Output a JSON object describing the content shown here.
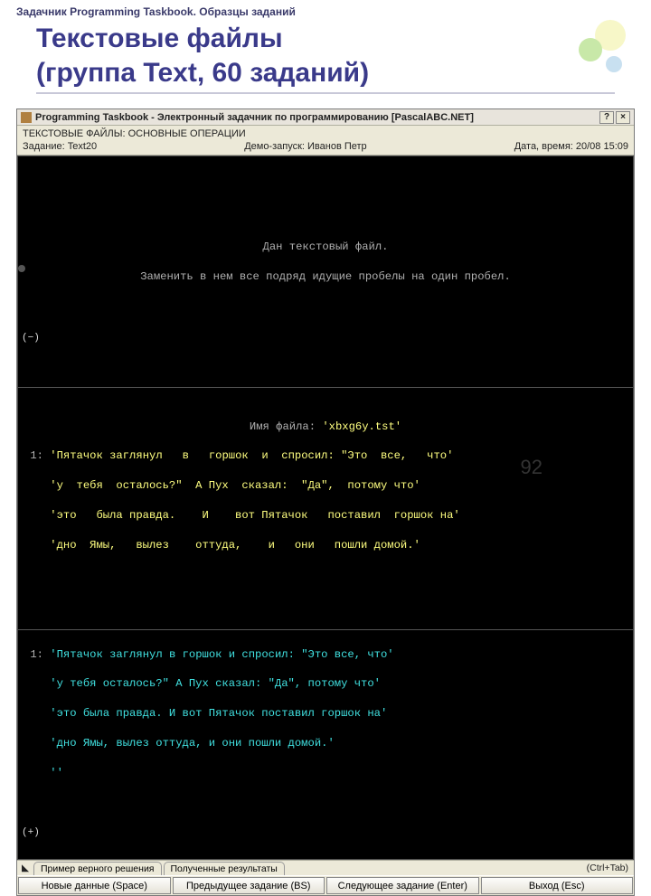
{
  "breadcrumb": "Задачник Programming Taskbook. Образцы заданий",
  "page_title_line1": "Текстовые файлы",
  "page_title_line2": "(группа Text, 60 заданий)",
  "window": {
    "title": "Programming Taskbook - Электронный задачник по программированию [PascalABC.NET]",
    "help_label": "?",
    "close_label": "×",
    "info": {
      "category": "ТЕКСТОВЫЕ ФАЙЛЫ: ОСНОВНЫЕ ОПЕРАЦИИ",
      "task_label": "Задание: Text20",
      "demo_label": "Демо-запуск: Иванов Петр",
      "datetime_label": "Дата, время: 20/08 15:09"
    }
  },
  "terminal": {
    "problem_line1": "Дан текстовый файл.",
    "problem_line2": "Заменить в нем все подряд идущие пробелы на один пробел.",
    "minus_mark": "(−)",
    "plus_mark": "(+)",
    "filename_prefix": "Имя файла: ",
    "filename": "'xbxg6y.tst'",
    "input_lines": [
      {
        "n": "1:",
        "t": "'Пятачок заглянул   в   горшок  и  спросил: \"Это  все,   что'"
      },
      {
        "n": "",
        "t": "'у  тебя  осталось?\"  А Пух  сказал:  \"Да\",  потому что'"
      },
      {
        "n": "",
        "t": "'это   была правда.    И    вот Пятачок   поставил  горшок на'"
      },
      {
        "n": "",
        "t": "'дно  Ямы,   вылез    оттуда,    и   они   пошли домой.'"
      }
    ],
    "output_lines": [
      {
        "n": "1:",
        "t": "'Пятачок заглянул в горшок и спросил: \"Это все, что'"
      },
      {
        "n": "",
        "t": "'у тебя осталось?\" А Пух сказал: \"Да\", потому что'"
      },
      {
        "n": "",
        "t": "'это была правда. И вот Пятачок поставил горшок на'"
      },
      {
        "n": "",
        "t": "'дно Ямы, вылез оттуда, и они пошли домой.'"
      },
      {
        "n": "",
        "t": "''"
      }
    ]
  },
  "tabs": {
    "left": "Пример верного решения",
    "right": "Полученные результаты",
    "hint": "(Ctrl+Tab)"
  },
  "buttons": {
    "new_data": "Новые данные (Space)",
    "prev": "Предыдущее задание (BS)",
    "next": "Следующее задание (Enter)",
    "exit": "Выход (Esc)"
  },
  "page_number": "92"
}
